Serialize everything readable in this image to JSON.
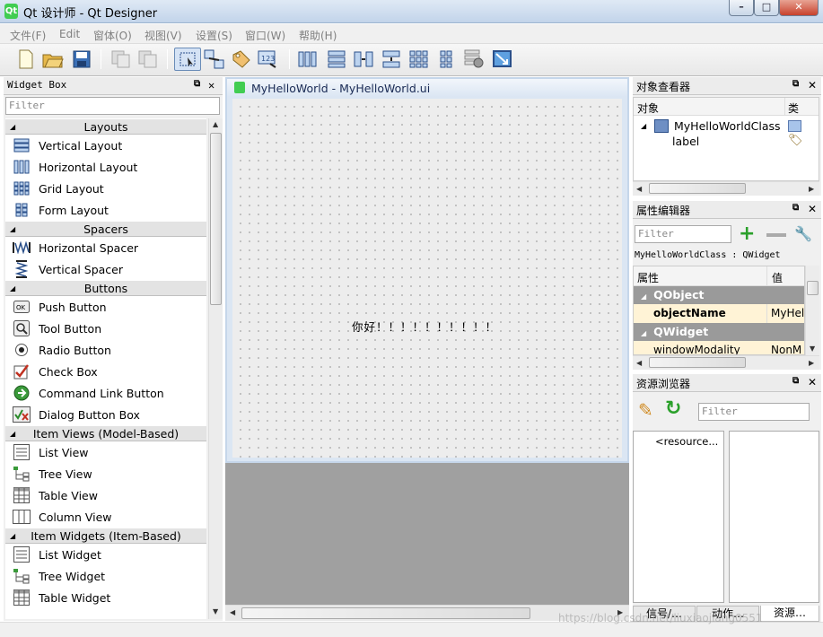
{
  "window": {
    "title": "Qt 设计师 - Qt Designer",
    "icon": "qt-logo-icon",
    "controls": [
      "minimize-icon",
      "maximize-icon",
      "close-icon"
    ]
  },
  "menu": [
    "文件(F)",
    "Edit",
    "窗体(O)",
    "视图(V)",
    "设置(S)",
    "窗口(W)",
    "帮助(H)"
  ],
  "toolbar": {
    "icons": [
      "new-file-icon",
      "open-folder-icon",
      "save-icon",
      "copy-disabled-icon",
      "paste-disabled-icon",
      "edit-widgets-icon",
      "edit-signals-slots-icon",
      "edit-buddies-icon",
      "edit-tab-order-icon",
      "layout-horizontal-icon",
      "layout-vertical-icon",
      "layout-h-splitter-icon",
      "layout-v-splitter-icon",
      "layout-grid-icon",
      "layout-form-icon",
      "break-layout-icon",
      "adjust-size-icon"
    ]
  },
  "widget_box": {
    "title": "Widget Box",
    "filter_placeholder": "Filter",
    "categories": [
      {
        "name": "Layouts",
        "items": [
          {
            "label": "Vertical Layout",
            "icon": "vertical-layout-icon"
          },
          {
            "label": "Horizontal Layout",
            "icon": "horizontal-layout-icon"
          },
          {
            "label": "Grid Layout",
            "icon": "grid-layout-icon"
          },
          {
            "label": "Form Layout",
            "icon": "form-layout-icon"
          }
        ]
      },
      {
        "name": "Spacers",
        "items": [
          {
            "label": "Horizontal Spacer",
            "icon": "horizontal-spacer-icon"
          },
          {
            "label": "Vertical Spacer",
            "icon": "vertical-spacer-icon"
          }
        ]
      },
      {
        "name": "Buttons",
        "items": [
          {
            "label": "Push Button",
            "icon": "push-button-icon"
          },
          {
            "label": "Tool Button",
            "icon": "tool-button-icon"
          },
          {
            "label": "Radio Button",
            "icon": "radio-button-icon"
          },
          {
            "label": "Check Box",
            "icon": "check-box-icon"
          },
          {
            "label": "Command Link Button",
            "icon": "command-link-icon"
          },
          {
            "label": "Dialog Button Box",
            "icon": "dialog-button-box-icon"
          }
        ]
      },
      {
        "name": "Item Views (Model-Based)",
        "items": [
          {
            "label": "List View",
            "icon": "list-view-icon"
          },
          {
            "label": "Tree View",
            "icon": "tree-view-icon"
          },
          {
            "label": "Table View",
            "icon": "table-view-icon"
          },
          {
            "label": "Column View",
            "icon": "column-view-icon"
          }
        ]
      },
      {
        "name": "Item Widgets (Item-Based)",
        "items": [
          {
            "label": "List Widget",
            "icon": "list-widget-icon"
          },
          {
            "label": "Tree Widget",
            "icon": "tree-widget-icon"
          },
          {
            "label": "Table Widget",
            "icon": "table-widget-icon"
          }
        ]
      }
    ]
  },
  "form": {
    "title": "MyHelloWorld - MyHelloWorld.ui",
    "label_text": "你好！！！！！！！！！！"
  },
  "object_inspector": {
    "title": "对象查看器",
    "col_object": "对象",
    "col_class": "类",
    "root": "MyHelloWorldClass",
    "child": "label"
  },
  "property_editor": {
    "title": "属性编辑器",
    "filter_placeholder": "Filter",
    "context": "MyHelloWorldClass : QWidget",
    "col_property": "属性",
    "col_value": "值",
    "groups": [
      {
        "name": "QObject",
        "rows": [
          {
            "property": "objectName",
            "value": "MyHel"
          }
        ]
      },
      {
        "name": "QWidget",
        "rows": [
          {
            "property": "windowModality",
            "value": "NonM"
          }
        ]
      }
    ]
  },
  "resource_browser": {
    "title": "资源浏览器",
    "filter_placeholder": "Filter",
    "root": "<resource...",
    "tabs": [
      "信号/…",
      "动作…",
      "资源…"
    ]
  },
  "watermark": "https://blog.csdn.net/liuxiaojiang0551"
}
